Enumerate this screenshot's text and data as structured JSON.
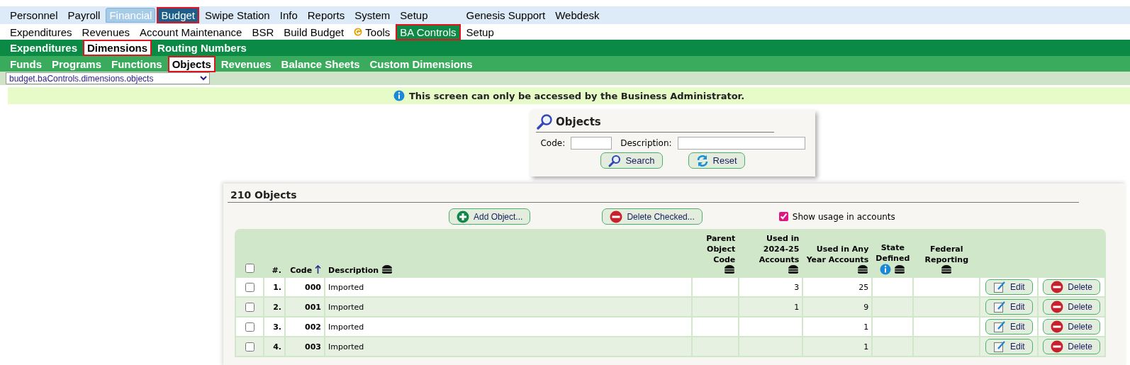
{
  "menus": [
    {
      "kind": "modules",
      "items": [
        {
          "label": "Personnel",
          "selected": false,
          "kind": "link"
        },
        {
          "label": "Payroll",
          "selected": false,
          "kind": "link"
        },
        {
          "label": "Financial",
          "selected": false,
          "kind": "parent"
        },
        {
          "label": "Budget",
          "selected": true,
          "kind": "link"
        },
        {
          "label": "Swipe Station",
          "selected": false,
          "kind": "link"
        },
        {
          "label": "Info",
          "selected": false,
          "kind": "link"
        },
        {
          "label": "Reports",
          "selected": false,
          "kind": "link"
        },
        {
          "label": "System",
          "selected": false,
          "kind": "link"
        },
        {
          "label": "Setup",
          "selected": false,
          "kind": "link"
        },
        {
          "label": "Genesis Support",
          "selected": false,
          "kind": "spaced"
        },
        {
          "label": "Webdesk",
          "selected": false,
          "kind": "link"
        }
      ]
    },
    {
      "kind": "sections",
      "items": [
        {
          "label": "Expenditures",
          "selected": false,
          "kind": "link"
        },
        {
          "label": "Revenues",
          "selected": false,
          "kind": "link"
        },
        {
          "label": "Account Maintenance",
          "selected": false,
          "kind": "link"
        },
        {
          "label": "BSR",
          "selected": false,
          "kind": "link"
        },
        {
          "label": "Build Budget",
          "selected": false,
          "kind": "link"
        },
        {
          "label": "Tools",
          "selected": false,
          "kind": "tool"
        },
        {
          "label": "BA Controls",
          "selected": true,
          "kind": "link"
        },
        {
          "label": "Setup",
          "selected": false,
          "kind": "link"
        }
      ]
    },
    {
      "kind": "subsections",
      "items": [
        {
          "label": "Expenditures",
          "selected": false,
          "kind": "link"
        },
        {
          "label": "Dimensions",
          "selected": true,
          "kind": "link"
        },
        {
          "label": "Routing Numbers",
          "selected": false,
          "kind": "link"
        }
      ]
    },
    {
      "kind": "pages",
      "items": [
        {
          "label": "Funds",
          "selected": false,
          "kind": "link"
        },
        {
          "label": "Programs",
          "selected": false,
          "kind": "link"
        },
        {
          "label": "Functions",
          "selected": false,
          "kind": "link"
        },
        {
          "label": "Objects",
          "selected": true,
          "kind": "link"
        },
        {
          "label": "Revenues",
          "selected": false,
          "kind": "link"
        },
        {
          "label": "Balance Sheets",
          "selected": false,
          "kind": "link"
        },
        {
          "label": "Custom Dimensions",
          "selected": false,
          "kind": "link"
        }
      ]
    }
  ],
  "screen_select": {
    "value": "budget.baControls.dimensions.objects"
  },
  "notice": "This screen can only be accessed by the Business Administrator.",
  "search": {
    "title": "Objects",
    "fields": [
      {
        "label": "Code:"
      },
      {
        "label": "Description:"
      }
    ],
    "buttons": [
      {
        "label": "Search",
        "kind": "search"
      },
      {
        "label": "Reset",
        "kind": "reset"
      }
    ]
  },
  "objects": {
    "title": "210 Objects",
    "buttons": [
      {
        "label": "Add Object...",
        "kind": "add"
      },
      {
        "label": "Delete Checked...",
        "kind": "delete"
      }
    ],
    "show_usage": {
      "label": "Show usage in accounts",
      "checked": true
    },
    "table": {
      "select_all": {
        "checked": false
      },
      "columns": [
        {
          "label": "#.",
          "kind": "plain"
        },
        {
          "label": "Code",
          "kind": "sorted"
        },
        {
          "label": "Description",
          "kind": "menu"
        },
        {
          "label": "Parent Object Code",
          "kind": "menu"
        },
        {
          "label": "Used in 2024-25 Accounts",
          "kind": "menu"
        },
        {
          "label": "Used in Any Year Accounts",
          "kind": "menu"
        },
        {
          "label": "State Defined",
          "kind": "info"
        },
        {
          "label": "Federal Reporting",
          "kind": "menu"
        }
      ],
      "rows": [
        {
          "checked": false,
          "cells": [
            "1.",
            "000",
            "Imported",
            "",
            "3",
            "25",
            "",
            ""
          ],
          "actions": [
            "Edit",
            "Delete"
          ]
        },
        {
          "checked": false,
          "cells": [
            "2.",
            "001",
            "Imported",
            "",
            "1",
            "9",
            "",
            ""
          ],
          "actions": [
            "Edit",
            "Delete"
          ]
        },
        {
          "checked": false,
          "cells": [
            "3.",
            "002",
            "Imported",
            "",
            "",
            "1",
            "",
            ""
          ],
          "actions": [
            "Edit",
            "Delete"
          ]
        },
        {
          "checked": false,
          "cells": [
            "4.",
            "003",
            "Imported",
            "",
            "",
            "1",
            "",
            ""
          ],
          "actions": [
            "Edit",
            "Delete"
          ]
        }
      ]
    }
  }
}
